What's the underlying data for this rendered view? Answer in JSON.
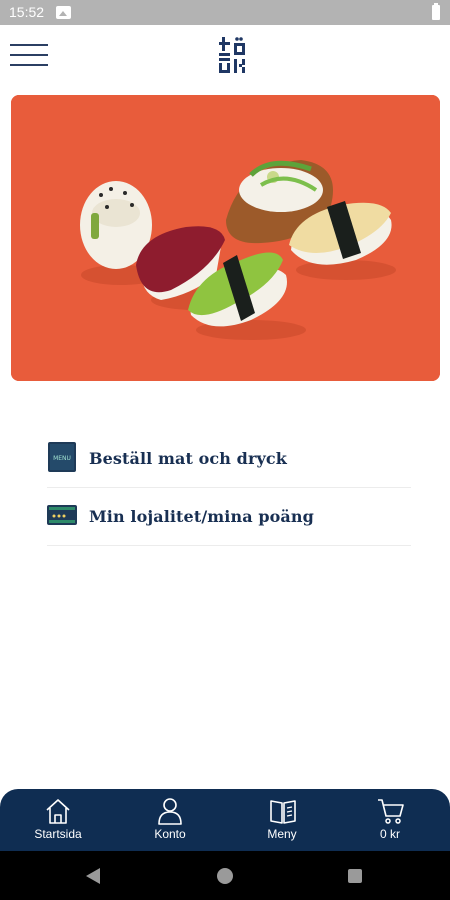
{
  "status_bar": {
    "time": "15:52",
    "icons": [
      "image-icon",
      "battery-icon"
    ]
  },
  "header": {
    "logo_icon": "itsu-logo-icon",
    "menu_icon": "hamburger-menu-icon"
  },
  "hero": {
    "image": "sushi-on-orange-background",
    "background_color": "#e85c3b"
  },
  "links": [
    {
      "label": "Beställ mat och dryck",
      "icon": "menu-book-icon",
      "icon_text": "MENU"
    },
    {
      "label": "Min lojalitet/mina poäng",
      "icon": "loyalty-card-icon"
    }
  ],
  "bottom_nav": {
    "items": [
      {
        "label": "Startsida",
        "icon": "home-icon"
      },
      {
        "label": "Konto",
        "icon": "user-icon"
      },
      {
        "label": "Meny",
        "icon": "menu-book-icon"
      },
      {
        "label": "0 kr",
        "icon": "cart-icon"
      }
    ],
    "background_color": "#0f2d52"
  },
  "system_nav": {
    "icons": [
      "back-icon",
      "home-circle-icon",
      "recents-icon"
    ]
  },
  "colors": {
    "navy": "#0f2d52",
    "text": "#182f52",
    "hero_orange": "#e85c3b"
  }
}
